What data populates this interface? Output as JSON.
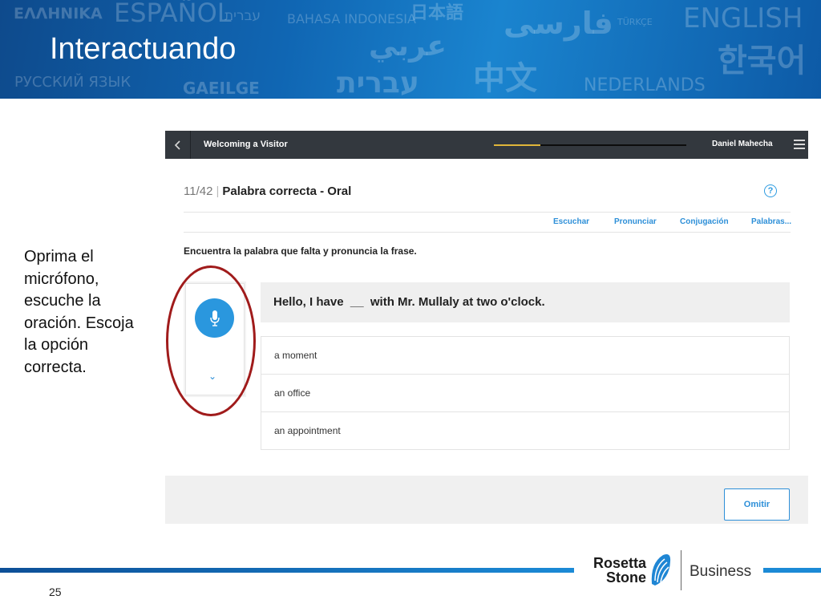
{
  "slide": {
    "title": "Interactuando",
    "page_number": "25",
    "background_words": [
      "ΕΛΛΗΝΙΚΑ",
      "ESPAÑOL",
      "עברית",
      "BAHASA INDONESIA",
      "日本語",
      "فارسی",
      "TÜRKÇE",
      "ENGLISH",
      "عربي",
      "한국어",
      "РУССКИЙ ЯЗЫК",
      "GAEILGE",
      "עברית",
      "中文",
      "NEDERLANDS"
    ],
    "instruction": "Oprima el micrófono, escuche la oración. Escoja la opción correcta.",
    "colors": {
      "banner_blue": "#1066b3",
      "accent_blue": "#2d8fd8",
      "annotation_red": "#a01b1b"
    }
  },
  "app": {
    "header": {
      "lesson_title": "Welcoming a Visitor",
      "progress_fraction": 0.24,
      "user_name": "Daniel Mahecha",
      "back_icon": "chevron-left-icon",
      "menu_icon": "hamburger-menu-icon"
    },
    "activity": {
      "count": "11/42",
      "separator": "|",
      "title": "Palabra correcta - Oral",
      "help_icon": "?"
    },
    "tools": [
      "Escuchar",
      "Pronunciar",
      "Conjugación",
      "Palabras..."
    ],
    "prompt": "Encuentra la palabra que falta y pronuncia la frase.",
    "sentence": "Hello, I have  __  with Mr. Mullaly at two o'clock.",
    "options": [
      "a moment",
      "an office",
      "an appointment"
    ],
    "skip_label": "Omitir",
    "chevron": "⌄"
  },
  "logo": {
    "rosetta": "Rosetta",
    "stone": "Stone",
    "business": "Business"
  }
}
